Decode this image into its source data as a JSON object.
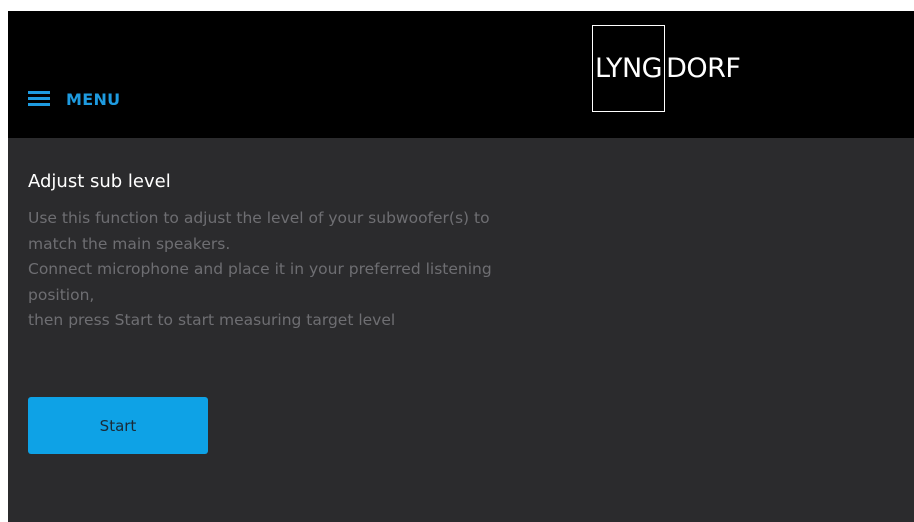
{
  "header": {
    "menu_label": "MENU",
    "logo_boxed": "LYNG",
    "logo_rest": "DORF"
  },
  "content": {
    "title": "Adjust sub level",
    "description_lines": [
      "Use this function to adjust the level of your subwoofer(s) to",
      "match the main speakers.",
      "Connect microphone and place it in your preferred listening",
      "position,",
      "then press Start to start measuring target level"
    ],
    "start_label": "Start"
  },
  "colors": {
    "accent": "#0ea2e6",
    "menu_accent": "#1e9be0",
    "header_bg": "#000000",
    "panel_bg": "#2b2b2d",
    "muted_text": "#6e6e72"
  },
  "icons": {
    "menu": "hamburger-icon"
  }
}
